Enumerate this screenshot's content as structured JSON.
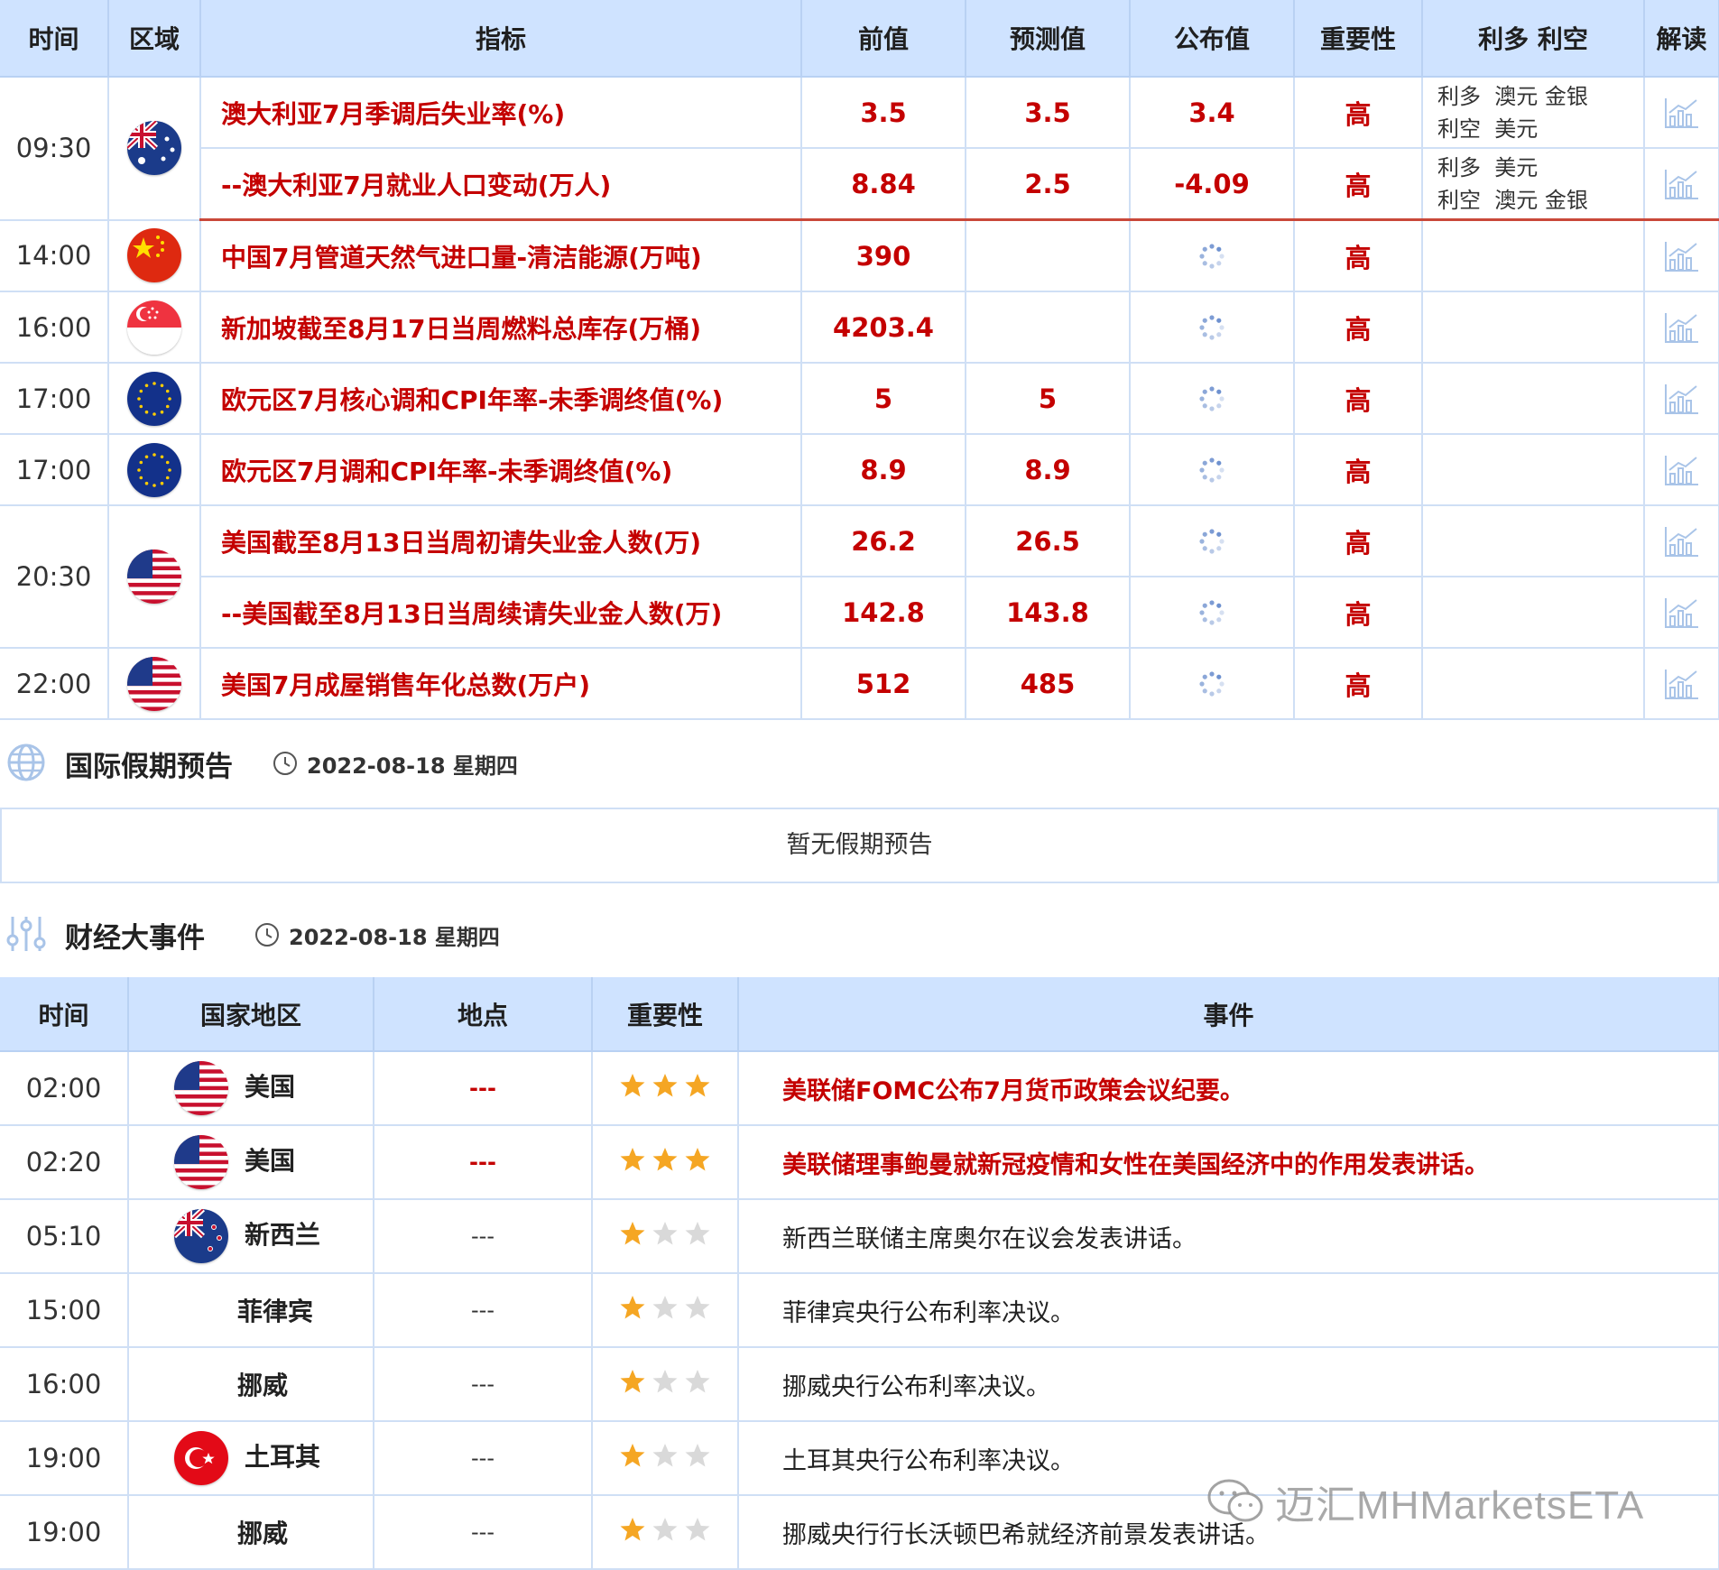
{
  "econ_table": {
    "headers": {
      "time": "时间",
      "region": "区域",
      "indicator": "指标",
      "previous": "前值",
      "forecast": "预测值",
      "actual": "公布值",
      "importance": "重要性",
      "bull_bear": "利多 利空",
      "interpret": "解读"
    },
    "groups": [
      {
        "time": "09:30",
        "flag": "australia",
        "rows": [
          {
            "indicator": "澳大利亚7月季调后失业率(%)",
            "previous": "3.5",
            "forecast": "3.5",
            "actual": "3.4",
            "importance": "高",
            "bull": "利多  澳元 金银",
            "bear": "利空  美元"
          },
          {
            "indicator": "--澳大利亚7月就业人口变动(万人)",
            "previous": "8.84",
            "forecast": "2.5",
            "actual": "-4.09",
            "importance": "高",
            "bull": "利多  美元",
            "bear": "利空  澳元 金银"
          }
        ]
      },
      {
        "time": "14:00",
        "flag": "china",
        "rows": [
          {
            "indicator": "中国7月管道天然气进口量-清洁能源(万吨)",
            "previous": "390",
            "forecast": "",
            "actual": "",
            "importance": "高",
            "bull": "",
            "bear": ""
          }
        ]
      },
      {
        "time": "16:00",
        "flag": "singapore",
        "rows": [
          {
            "indicator": "新加坡截至8月17日当周燃料总库存(万桶)",
            "previous": "4203.4",
            "forecast": "",
            "actual": "",
            "importance": "高",
            "bull": "",
            "bear": ""
          }
        ]
      },
      {
        "time": "17:00",
        "flag": "eu",
        "rows": [
          {
            "indicator": "欧元区7月核心调和CPI年率-未季调终值(%)",
            "previous": "5",
            "forecast": "5",
            "actual": "",
            "importance": "高",
            "bull": "",
            "bear": ""
          }
        ]
      },
      {
        "time": "17:00",
        "flag": "eu",
        "rows": [
          {
            "indicator": "欧元区7月调和CPI年率-未季调终值(%)",
            "previous": "8.9",
            "forecast": "8.9",
            "actual": "",
            "importance": "高",
            "bull": "",
            "bear": ""
          }
        ]
      },
      {
        "time": "20:30",
        "flag": "usa",
        "rows": [
          {
            "indicator": "美国截至8月13日当周初请失业金人数(万)",
            "previous": "26.2",
            "forecast": "26.5",
            "actual": "",
            "importance": "高",
            "bull": "",
            "bear": ""
          },
          {
            "indicator": "--美国截至8月13日当周续请失业金人数(万)",
            "previous": "142.8",
            "forecast": "143.8",
            "actual": "",
            "importance": "高",
            "bull": "",
            "bear": ""
          }
        ]
      },
      {
        "time": "22:00",
        "flag": "usa",
        "rows": [
          {
            "indicator": "美国7月成屋销售年化总数(万户)",
            "previous": "512",
            "forecast": "485",
            "actual": "",
            "importance": "高",
            "bull": "",
            "bear": ""
          }
        ]
      }
    ]
  },
  "holiday_section": {
    "icon": "globe-icon",
    "title": "国际假期预告",
    "date": "2022-08-18 星期四",
    "empty_text": "暂无假期预告"
  },
  "events_section": {
    "icon": "sliders-icon",
    "title": "财经大事件",
    "date": "2022-08-18 星期四"
  },
  "events_table": {
    "headers": {
      "time": "时间",
      "country": "国家地区",
      "place": "地点",
      "importance": "重要性",
      "event": "事件"
    },
    "rows": [
      {
        "time": "02:00",
        "country": "美国",
        "flag": "usa",
        "place": "---",
        "stars": 3,
        "event": "美联储FOMC公布7月货币政策会议纪要。",
        "highlight": true
      },
      {
        "time": "02:20",
        "country": "美国",
        "flag": "usa",
        "place": "---",
        "stars": 3,
        "event": "美联储理事鲍曼就新冠疫情和女性在美国经济中的作用发表讲话。",
        "highlight": true
      },
      {
        "time": "05:10",
        "country": "新西兰",
        "flag": "newzealand",
        "place": "---",
        "stars": 1,
        "event": "新西兰联储主席奥尔在议会发表讲话。",
        "highlight": false
      },
      {
        "time": "15:00",
        "country": "菲律宾",
        "flag": "",
        "place": "---",
        "stars": 1,
        "event": "菲律宾央行公布利率决议。",
        "highlight": false
      },
      {
        "time": "16:00",
        "country": "挪威",
        "flag": "",
        "place": "---",
        "stars": 1,
        "event": "挪威央行公布利率决议。",
        "highlight": false
      },
      {
        "time": "19:00",
        "country": "土耳其",
        "flag": "turkey",
        "place": "---",
        "stars": 1,
        "event": "土耳其央行公布利率决议。",
        "highlight": false
      },
      {
        "time": "19:00",
        "country": "挪威",
        "flag": "",
        "place": "---",
        "stars": 1,
        "event": "挪威央行行长沃顿巴希就经济前景发表讲话。",
        "highlight": false
      }
    ]
  },
  "watermark": {
    "icon": "wechat-icon",
    "text": "迈汇MHMarketsETA"
  },
  "colors": {
    "header_bg": "#cfe3ff",
    "highlight_red": "#c40000",
    "border": "#cfdff5",
    "separator": "#c9483a",
    "star_on": "#f5a623",
    "star_off": "#d9d9d9"
  }
}
